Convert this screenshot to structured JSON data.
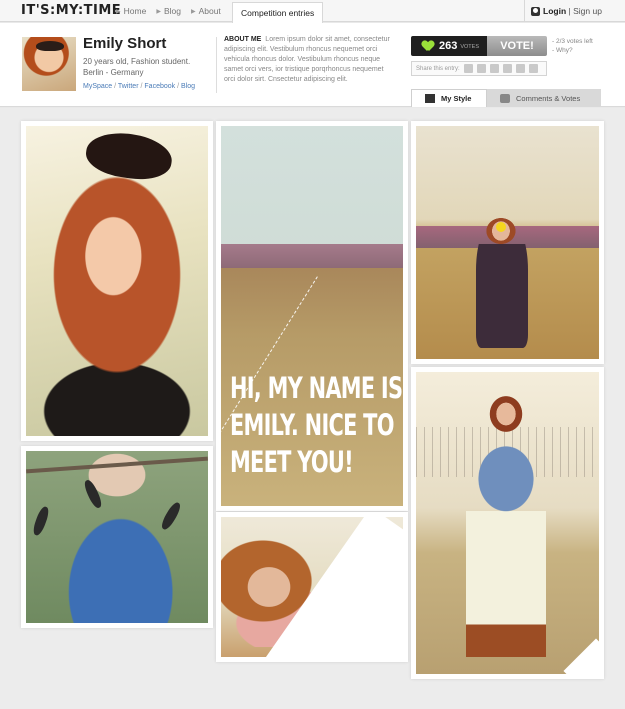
{
  "site": {
    "logo": "IT'S:MY:TIME"
  },
  "nav": {
    "items": [
      "Home",
      "Blog",
      "About"
    ],
    "active_tab": "Competition entries"
  },
  "auth": {
    "login": "Login",
    "separator": "|",
    "signup": "Sign up"
  },
  "profile": {
    "name": "Emily Short",
    "line1": "20 years old, Fashion student.",
    "line2": "Berlin - Germany",
    "links": [
      "MySpace",
      "Twitter",
      "Facebook",
      "Blog"
    ],
    "link_separator": "/"
  },
  "about": {
    "label": "ABOUT ME",
    "text": "Lorem ipsum dolor sit amet, consectetur adipiscing elit. Vestibulum rhoncus nequemet orci vehicula rhoncus dolor. Vestibulum rhoncus neque samet orci vers, ior tristique porqrhoncus nequemet orci dolor sirt. Cnsectetur adipiscing elit."
  },
  "vote": {
    "count": "263",
    "count_label": "VOTES",
    "button": "VOTE!",
    "votes_left": "- 2/3 votes left",
    "why": "- Why?"
  },
  "share": {
    "label": "Share this entry:"
  },
  "tabs": {
    "my_style": "My Style",
    "comments": "Comments & Votes"
  },
  "gallery": {
    "headline": "HI, MY NAME IS EMILY. NICE TO MEET YOU!"
  },
  "colors": {
    "accent_green": "#9be13a",
    "link_blue": "#4a7bb7",
    "vote_dark": "#1f1f1f"
  }
}
